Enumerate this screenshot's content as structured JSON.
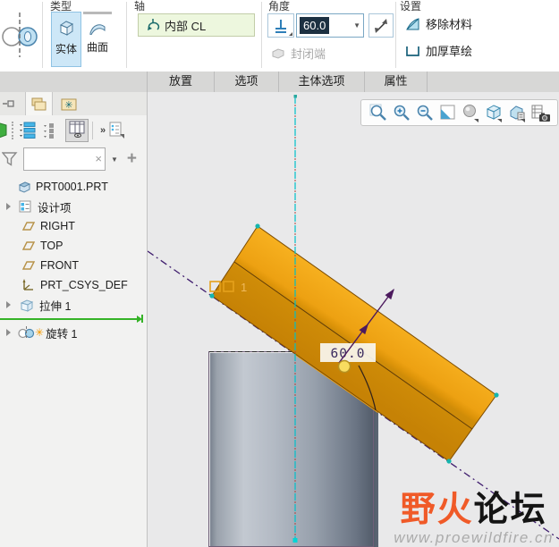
{
  "ribbon": {
    "type": {
      "label": "类型",
      "solid": "实体",
      "surface": "曲面"
    },
    "axis": {
      "label": "轴",
      "collector": "内部 CL"
    },
    "angle": {
      "label": "角度",
      "value": "60.0",
      "closed_ends": "封闭端"
    },
    "settings": {
      "label": "设置",
      "remove_material": "移除材料",
      "thicken_sketch": "加厚草绘"
    }
  },
  "tabs": {
    "placement": "放置",
    "options": "选项",
    "body_options": "主体选项",
    "properties": "属性"
  },
  "sidebar": {
    "overflow": "»",
    "search": {
      "value": "",
      "placeholder": ""
    },
    "root": "PRT0001.PRT",
    "items": [
      {
        "label": "设计项"
      },
      {
        "label": "RIGHT"
      },
      {
        "label": "TOP"
      },
      {
        "label": "FRONT"
      },
      {
        "label": "PRT_CSYS_DEF"
      },
      {
        "label": "拉伸 1"
      },
      {
        "label": "旋转 1",
        "badge": "✳"
      }
    ]
  },
  "canvas": {
    "angle_dim": "60.0",
    "section_label": "1",
    "watermark": {
      "brand_orange": "野火",
      "brand_black": "论坛",
      "url": "www.proewildfire.cn"
    }
  },
  "glyphs": {
    "clear": "×",
    "dropdown": "▼",
    "add": "+"
  },
  "colors": {
    "accent_blue": "#2e7fb8",
    "selected_button_bg": "#cde7f7",
    "collector_green": "#edf7de",
    "slab_orange": "#eea011",
    "slab_orange_dark": "#c98406",
    "insert_line_green": "#35b327",
    "watermark_orange": "#f05a28",
    "centerline_cyan": "#00bfc9",
    "construction_purple": "#3f1d6e",
    "highlight_teal": "#16b5ad"
  }
}
